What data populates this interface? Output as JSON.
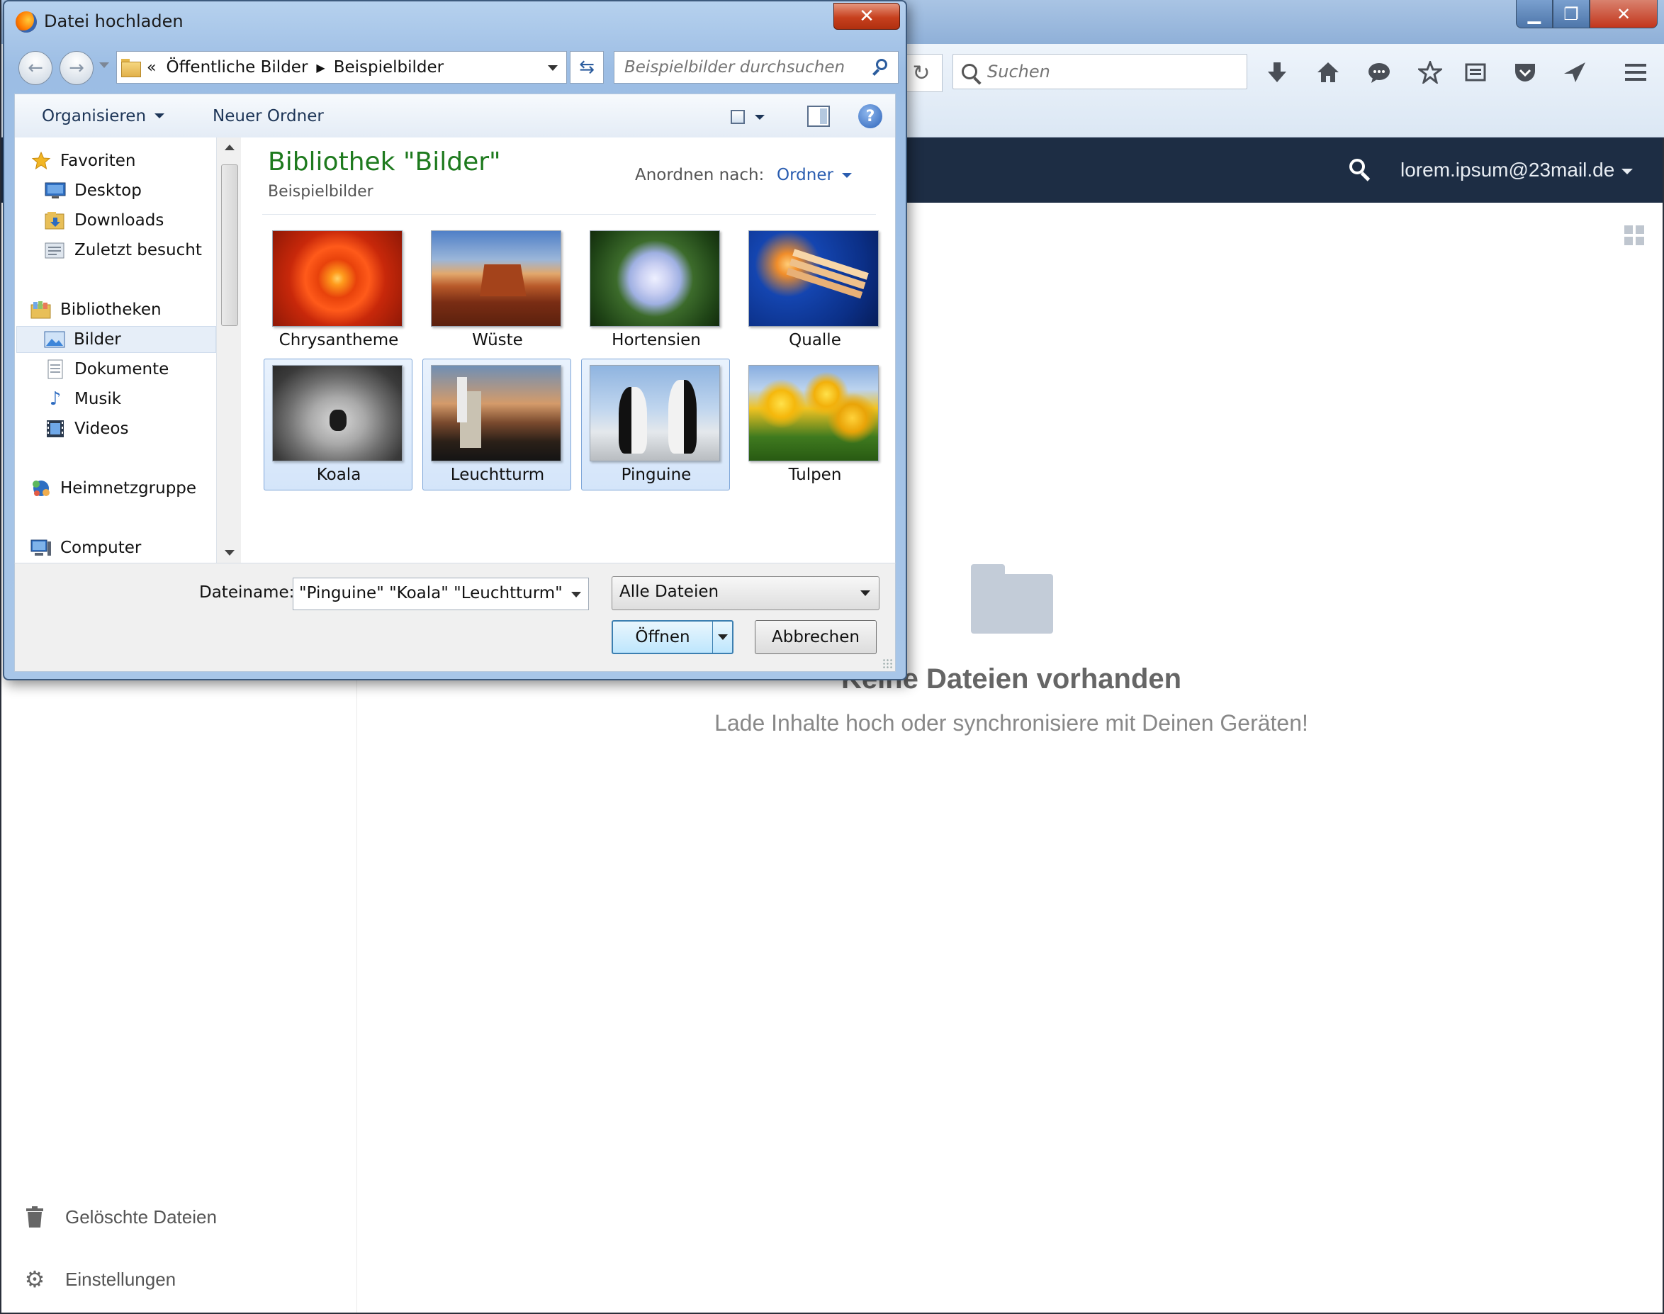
{
  "browser": {
    "search_placeholder": "Suchen",
    "window_buttons": {
      "minimize": "▁",
      "maximize": "❐",
      "close": "✕"
    },
    "toolbar_icons": [
      "reload-icon",
      "download-icon",
      "home-icon",
      "chat-icon",
      "bookmark-star-icon",
      "reading-list-icon",
      "pocket-icon",
      "send-icon",
      "menu-icon"
    ]
  },
  "app": {
    "user_email": "lorem.ipsum@23mail.de",
    "empty_title": "Keine Dateien vorhanden",
    "empty_subtitle": "Lade Inhalte hoch oder synchronisiere mit Deinen Geräten!",
    "sidebar_bottom": [
      {
        "label": "Gelöschte Dateien",
        "icon": "trash-icon"
      },
      {
        "label": "Einstellungen",
        "icon": "gear-icon"
      }
    ],
    "header_color": "#1d2d44"
  },
  "dialog": {
    "title": "Datei hochladen",
    "close_label": "✕",
    "breadcrumb": {
      "overflow": "«",
      "items": [
        "Öffentliche Bilder",
        "Beispielbilder"
      ]
    },
    "search_placeholder": "Beispielbilder durchsuchen",
    "commands": {
      "organize": "Organisieren",
      "new_folder": "Neuer Ordner",
      "help": "?"
    },
    "nav": {
      "favorites": {
        "label": "Favoriten",
        "items": [
          "Desktop",
          "Downloads",
          "Zuletzt besucht"
        ]
      },
      "libraries": {
        "label": "Bibliotheken",
        "items": [
          "Bilder",
          "Dokumente",
          "Musik",
          "Videos"
        ]
      },
      "homegroup": "Heimnetzgruppe",
      "computer": "Computer",
      "selected": "Bilder"
    },
    "library": {
      "title": "Bibliothek \"Bilder\"",
      "subtitle": "Beispielbilder",
      "arrange_label": "Anordnen nach:",
      "arrange_value": "Ordner"
    },
    "files": [
      {
        "name": "Chrysantheme",
        "selected": false
      },
      {
        "name": "Wüste",
        "selected": false
      },
      {
        "name": "Hortensien",
        "selected": false
      },
      {
        "name": "Qualle",
        "selected": false
      },
      {
        "name": "Koala",
        "selected": true
      },
      {
        "name": "Leuchtturm",
        "selected": true
      },
      {
        "name": "Pinguine",
        "selected": true
      },
      {
        "name": "Tulpen",
        "selected": false
      }
    ],
    "filename_label": "Dateiname:",
    "filename_value": "\"Pinguine\" \"Koala\" \"Leuchtturm\"",
    "filetype_value": "Alle Dateien",
    "open_label": "Öffnen",
    "cancel_label": "Abbrechen",
    "title_color": "#1e7a1e"
  }
}
